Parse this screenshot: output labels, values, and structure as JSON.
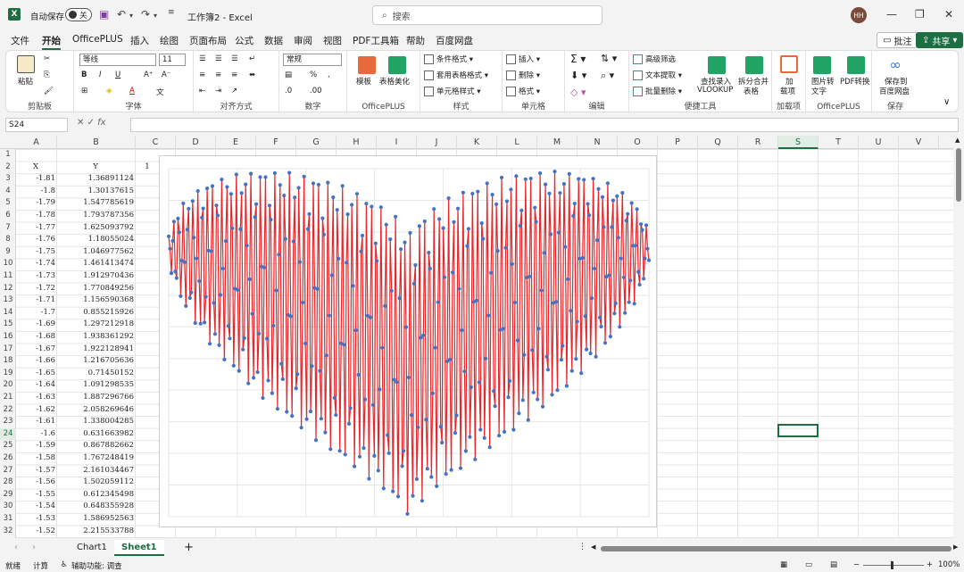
{
  "titlebar": {
    "autosave_label": "自动保存",
    "autosave_state": "关",
    "document_title": "工作簿2 - Excel",
    "search_placeholder": "搜索",
    "user_initials": "HH"
  },
  "menu": {
    "items": [
      "文件",
      "开始",
      "OfficePLUS",
      "插入",
      "绘图",
      "页面布局",
      "公式",
      "数据",
      "审阅",
      "视图",
      "PDF工具箱",
      "帮助",
      "百度网盘"
    ],
    "active": "开始",
    "comment_button": "批注",
    "share_button": "共享"
  },
  "ribbon": {
    "clipboard": {
      "label": "剪贴板",
      "paste": "粘贴"
    },
    "font": {
      "label": "字体",
      "font_name": "等线",
      "font_size": "11"
    },
    "alignment": {
      "label": "对齐方式"
    },
    "number": {
      "label": "数字",
      "format": "常规"
    },
    "officeplus": {
      "label": "OfficePLUS",
      "template": "模板",
      "beautify": "表格美化"
    },
    "styles": {
      "label": "样式",
      "conditional": "条件格式",
      "table_format": "套用表格格式",
      "cell_style": "单元格样式"
    },
    "cells": {
      "label": "单元格",
      "insert": "插入",
      "delete": "删除",
      "format": "格式"
    },
    "editing": {
      "label": "编辑"
    },
    "tools": {
      "label": "便捷工具",
      "advanced_filter": "高级筛选",
      "text_extract": "文本提取",
      "batch_delete": "批量删除",
      "vlookup_line1": "查找录入",
      "vlookup_line2": "VLOOKUP",
      "split_line1": "拆分合并",
      "split_line2": "表格"
    },
    "addins": {
      "label": "加载项",
      "line1": "加",
      "line2": "载项"
    },
    "officeplus2": {
      "label": "OfficePLUS",
      "img2text_line1": "图片转",
      "img2text_line2": "文字",
      "pdf_convert": "PDF转换"
    },
    "save": {
      "label": "保存",
      "line1": "保存到",
      "line2": "百度网盘"
    }
  },
  "formula_bar": {
    "name_box": "S24",
    "fx": "fx",
    "content": ""
  },
  "sheet": {
    "columns": [
      "A",
      "B",
      "C",
      "D",
      "E",
      "F",
      "G",
      "H",
      "I",
      "J",
      "K",
      "L",
      "M",
      "N",
      "O",
      "P",
      "Q",
      "R",
      "S",
      "T",
      "U",
      "V"
    ],
    "selected_column": "S",
    "selected_row": "24",
    "row_numbers": [
      "1",
      "2",
      "3",
      "4",
      "5",
      "6",
      "7",
      "8",
      "9",
      "10",
      "11",
      "12",
      "13",
      "14",
      "15",
      "16",
      "17",
      "18",
      "19",
      "20",
      "21",
      "22",
      "23",
      "24",
      "25",
      "26",
      "27",
      "28",
      "29",
      "30",
      "31",
      "32"
    ],
    "header_x": "X",
    "header_y": "Y",
    "c2_value": "1",
    "x_values": [
      "-1.81",
      "-1.8",
      "-1.79",
      "-1.78",
      "-1.77",
      "-1.76",
      "-1.75",
      "-1.74",
      "-1.73",
      "-1.72",
      "-1.71",
      "-1.7",
      "-1.69",
      "-1.68",
      "-1.67",
      "-1.66",
      "-1.65",
      "-1.64",
      "-1.63",
      "-1.62",
      "-1.61",
      "-1.6",
      "-1.59",
      "-1.58",
      "-1.57",
      "-1.56",
      "-1.55",
      "-1.54",
      "-1.53",
      "-1.52"
    ],
    "y_values": [
      "1.36891124",
      "1.30137615",
      "1.547785619",
      "1.793787356",
      "1.625093792",
      "1.18055024",
      "1.046977562",
      "1.461413474",
      "1.912970436",
      "1.770849256",
      "1.156590368",
      "0.855215926",
      "1.297212918",
      "1.938361292",
      "1.922128941",
      "1.216705636",
      "0.71450152",
      "1.091298535",
      "1.887296766",
      "2.058269646",
      "1.338004285",
      "0.631663982",
      "0.867882662",
      "1.767248419",
      "2.161034467",
      "1.502059112",
      "0.612345498",
      "0.648355928",
      "1.586952563",
      "2.215533788"
    ]
  },
  "chart_data": {
    "type": "scatter",
    "mode": "lines+markers",
    "series": [
      {
        "name": "",
        "line_color": "#e8262a",
        "marker_color": "#4472c4"
      }
    ],
    "formula": "y = x^(2/3) + 0.9*sqrt(3.3 - x^2)*sin(k*pi*x)",
    "x_range": [
      -1.81,
      1.81
    ],
    "x_step": 0.01,
    "grid": true,
    "legend": "none"
  },
  "tabs": {
    "items": [
      "Chart1",
      "Sheet1"
    ],
    "active": "Sheet1",
    "add": "+"
  },
  "status": {
    "ready": "就绪",
    "calc": "计算",
    "accessibility": "辅助功能: 调查",
    "zoom": "100%"
  }
}
